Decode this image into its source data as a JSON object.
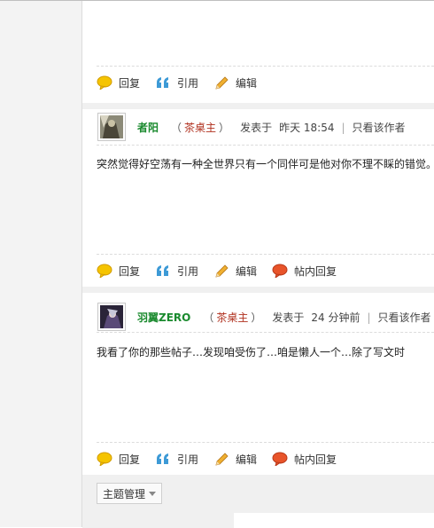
{
  "actions_basic": {
    "reply": "回复",
    "quote": "引用",
    "edit": "编辑"
  },
  "actions_full": {
    "reply": "回复",
    "quote": "引用",
    "edit": "编辑",
    "inline_reply": "帖内回复"
  },
  "posts": [
    {
      "author": "者阳",
      "role": "茶桌主",
      "posted_label": "发表于",
      "posted_time": "昨天 18:54",
      "only_author": "只看该作者",
      "text": "突然觉得好空荡有一种全世界只有一个同伴可是他对你不理不睬的错觉。"
    },
    {
      "author": "羽翼ZERO",
      "role": "茶桌主",
      "posted_label": "发表于",
      "posted_time": "24 分钟前",
      "only_author": "只看该作者",
      "text": "我看了你的那些帖子…发现咱受伤了…咱是懒人一个…除了写文时"
    }
  ],
  "paren_open": "（",
  "paren_close": "）",
  "pipe": "|",
  "topic_manage": "主题管理",
  "colors": {
    "author": "#1a8a2e",
    "role": "#b0301e",
    "separator": "#f0f0f0"
  }
}
